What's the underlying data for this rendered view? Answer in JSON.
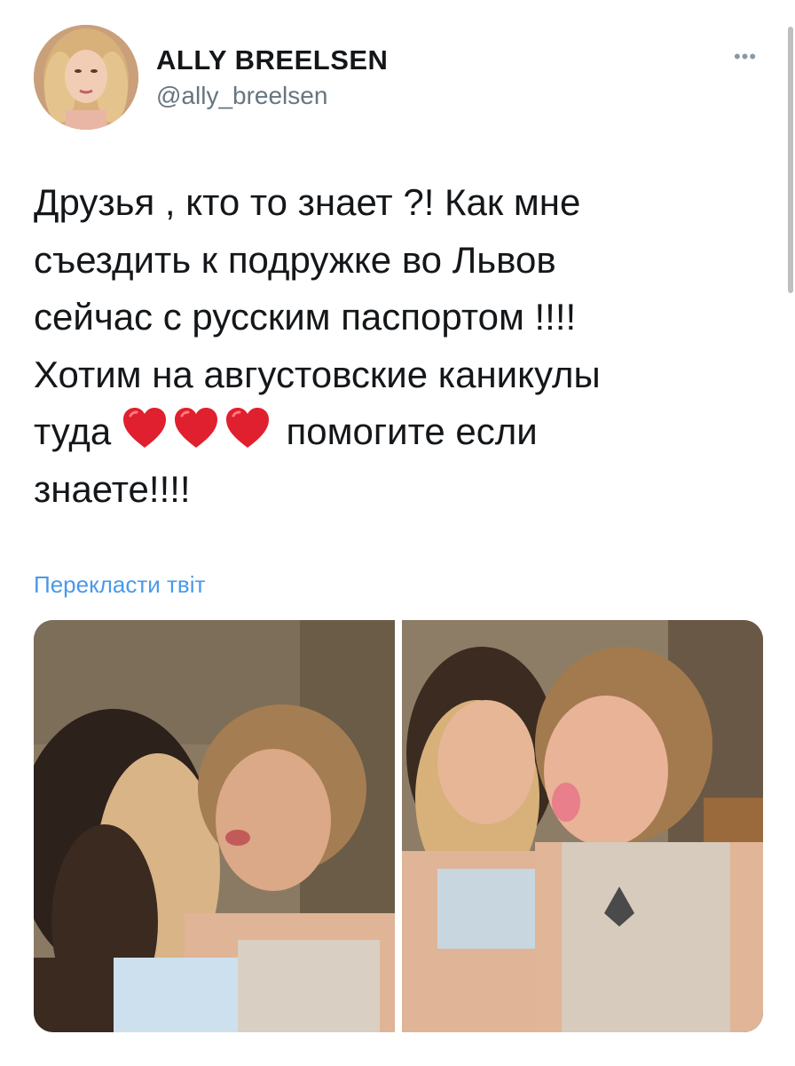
{
  "tweet": {
    "display_name": "ALLY BREELSEN",
    "handle": "@ally_breelsen",
    "more_icon": "more-dots-icon",
    "text_lines": [
      "Друзья , кто то знает ?! Как мне",
      "съездить к подружке во Львов",
      "сейчас с русским паспортом !!!!",
      "Хотим на августовские каникулы"
    ],
    "line5_before": "туда ",
    "line5_after": " помогите если",
    "line6": "знаете!!!!",
    "emoji": "red-heart-icon",
    "translate_label": "Перекласти твіт"
  },
  "colors": {
    "link": "#4a99e9",
    "text": "#14171a",
    "secondary": "#66757f",
    "heart": "#e0202e"
  }
}
